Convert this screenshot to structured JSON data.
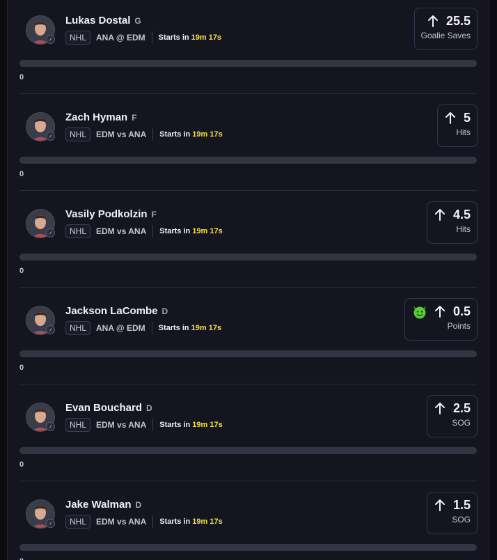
{
  "players": [
    {
      "name": "Lukas Dostal",
      "position": "G",
      "league": "NHL",
      "matchup": "ANA @ EDM",
      "starts_label": "Starts in",
      "starts_time": "19m 17s",
      "line": "25.5",
      "stat": "Goalie Saves",
      "progress_text": "0",
      "progress": 0,
      "direction_icon": "arrow-up-icon",
      "badge_icon": null
    },
    {
      "name": "Zach Hyman",
      "position": "F",
      "league": "NHL",
      "matchup": "EDM vs ANA",
      "starts_label": "Starts in",
      "starts_time": "19m 17s",
      "line": "5",
      "stat": "Hits",
      "progress_text": "0",
      "progress": 0,
      "direction_icon": "arrow-up-icon",
      "badge_icon": null
    },
    {
      "name": "Vasily Podkolzin",
      "position": "F",
      "league": "NHL",
      "matchup": "EDM vs ANA",
      "starts_label": "Starts in",
      "starts_time": "19m 17s",
      "line": "4.5",
      "stat": "Hits",
      "progress_text": "0",
      "progress": 0,
      "direction_icon": "arrow-up-icon",
      "badge_icon": null
    },
    {
      "name": "Jackson LaCombe",
      "position": "D",
      "league": "NHL",
      "matchup": "ANA @ EDM",
      "starts_label": "Starts in",
      "starts_time": "19m 17s",
      "line": "0.5",
      "stat": "Points",
      "progress_text": "0",
      "progress": 0,
      "direction_icon": "arrow-up-icon",
      "badge_icon": "green-devil-icon"
    },
    {
      "name": "Evan Bouchard",
      "position": "D",
      "league": "NHL",
      "matchup": "EDM vs ANA",
      "starts_label": "Starts in",
      "starts_time": "19m 17s",
      "line": "2.5",
      "stat": "SOG",
      "progress_text": "0",
      "progress": 0,
      "direction_icon": "arrow-up-icon",
      "badge_icon": null
    },
    {
      "name": "Jake Walman",
      "position": "D",
      "league": "NHL",
      "matchup": "EDM vs ANA",
      "starts_label": "Starts in",
      "starts_time": "19m 17s",
      "line": "1.5",
      "stat": "SOG",
      "progress_text": "0",
      "progress": 0,
      "direction_icon": "arrow-up-icon",
      "badge_icon": null
    }
  ],
  "colors": {
    "background": "#151520",
    "countdown": "#f3e24a",
    "progress_track": "#343543",
    "badge_green": "#5cc93a"
  }
}
